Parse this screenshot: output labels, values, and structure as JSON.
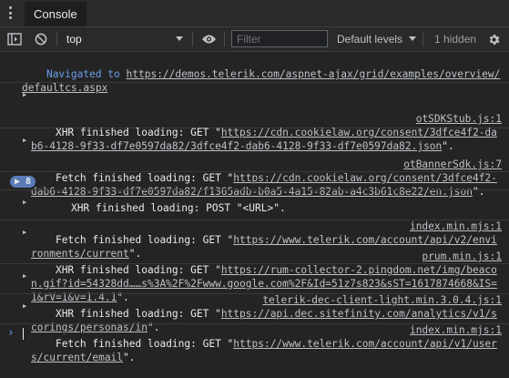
{
  "tabbar": {
    "tab_label": "Console"
  },
  "toolbar": {
    "context": "top",
    "filter_placeholder": "Filter",
    "levels_label": "Default levels",
    "hidden_count": "1 hidden"
  },
  "messages": [
    {
      "kind": "nav",
      "text": "Navigated to ",
      "link": "https://demos.telerik.com/aspnet-ajax/grid/examples/overview/defaultcs.aspx"
    },
    {
      "kind": "xhr",
      "prefix": "XHR finished loading: GET \"",
      "link": "https://cdn.cookielaw.org/consent/3dfce4f2-dab6-4128-9f33-df7e0597da82/3dfce4f2-dab6-4128-9f33-df7e0597da82.json",
      "suffix": "\".",
      "source": "otSDKStub.js:1"
    },
    {
      "kind": "fetch",
      "prefix": "Fetch finished loading: GET \"",
      "link": "https://cdn.cookielaw.org/consent/3dfce4f2-dab6-4128-9f33-df7e0597da82/f1365adb-b0a5-4a15-82ab-a4c3b61c8e22/en.json",
      "suffix": "\".",
      "source": "otBannerSdk.js:7"
    },
    {
      "kind": "grouped",
      "count": "8",
      "text": "XHR finished loading: POST \"<URL>\"."
    },
    {
      "kind": "fetch",
      "prefix": "Fetch finished loading: GET \"",
      "link": "https://www.telerik.com/account/api/v2/environments/current",
      "suffix": "\".",
      "source": "index.min.mjs:1"
    },
    {
      "kind": "xhr",
      "prefix": "XHR finished loading: GET \"",
      "link": "https://rum-collector-2.pingdom.net/img/beacon.gif?id=54328dd……s%3A%2F%2Fwww.google.com%2F&Id=51z7s823&sST=1617874668&IS=1&rV=1&v=1.4.1",
      "suffix": "\".",
      "source": "prum.min.js:1"
    },
    {
      "kind": "xhr",
      "prefix": "XHR finished loading: GET \"",
      "link": "https://api.dec.sitefinity.com/analytics/v1/scorings/personas/in",
      "suffix": "\".",
      "source": "telerik-dec-client-light.min.3.0.4.js:1"
    },
    {
      "kind": "fetch",
      "prefix": "Fetch finished loading: GET \"",
      "link": "https://www.telerik.com/account/api/v1/users/current/email",
      "suffix": "\".",
      "source": "index.min.mjs:1"
    }
  ]
}
